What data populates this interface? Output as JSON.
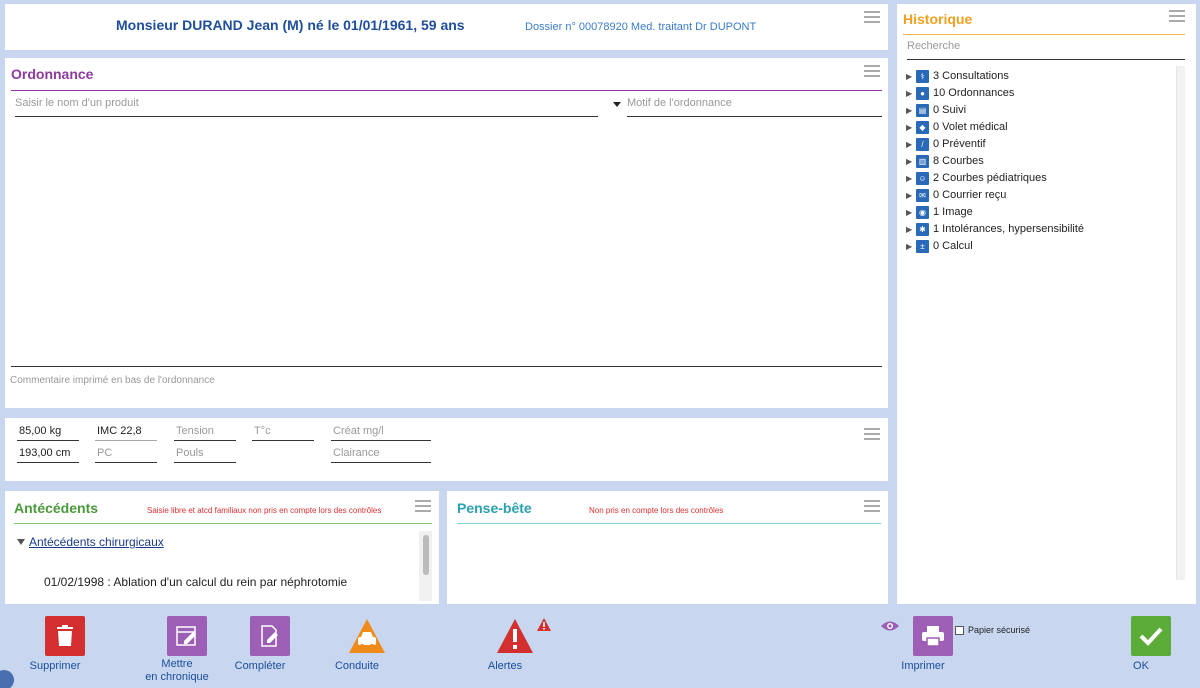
{
  "header": {
    "patient_name": "Monsieur DURAND Jean (M) né le 01/01/1961, 59 ans",
    "dossier": "Dossier n° 00078920 Med. traitant Dr DUPONT"
  },
  "ordonnance": {
    "title": "Ordonnance",
    "product_placeholder": "Saisir le nom d'un produit",
    "motif_placeholder": "Motif de l'ordonnance",
    "comment_placeholder": "Commentaire imprimé en bas de l'ordonnance"
  },
  "vitals": {
    "weight": "85,00 kg",
    "height": "193,00 cm",
    "imc": "IMC 22,8",
    "pc": "PC",
    "tension": "Tension",
    "pouls": "Pouls",
    "temp": "T°c",
    "creat": "Créat mg/l",
    "clairance": "Clairance"
  },
  "antecedents": {
    "title": "Antécédents",
    "note": "Saisie libre et atcd familiaux non pris en compte lors des contrôles",
    "group_label": "Antécédents chirurgicaux",
    "entry": "01/02/1998 : Ablation d'un calcul du rein par néphrotomie"
  },
  "pense_bete": {
    "title": "Pense-bête",
    "note": "Non pris en compte lors des contrôles"
  },
  "historique": {
    "title": "Historique",
    "search_placeholder": "Recherche",
    "items": [
      {
        "label": "3 Consultations",
        "icon": "stethoscope-icon"
      },
      {
        "label": "10 Ordonnances",
        "icon": "pill-icon"
      },
      {
        "label": "0 Suivi",
        "icon": "clipboard-icon"
      },
      {
        "label": "0 Volet médical",
        "icon": "group-icon"
      },
      {
        "label": "0 Préventif",
        "icon": "syringe-icon"
      },
      {
        "label": "8 Courbes",
        "icon": "chart-icon"
      },
      {
        "label": "2 Courbes pédiatriques",
        "icon": "baby-icon"
      },
      {
        "label": "0 Courrier reçu",
        "icon": "mail-icon"
      },
      {
        "label": "1 Image",
        "icon": "camera-icon"
      },
      {
        "label": "1 Intolérances, hypersensibilité",
        "icon": "bug-icon"
      },
      {
        "label": "0 Calcul",
        "icon": "calculator-icon"
      }
    ]
  },
  "toolbar": {
    "supprimer": "Supprimer",
    "chronique_line1": "Mettre",
    "chronique_line2": "en chronique",
    "completer": "Compléter",
    "conduite": "Conduite",
    "alertes": "Alertes",
    "imprimer": "Imprimer",
    "papier_securise": "Papier sécurisé",
    "ok": "OK"
  },
  "colors": {
    "accent_blue": "#1f4e9c",
    "ordonnance_purple": "#8e3a9e",
    "antecedents_green": "#4a9a3a",
    "pense_bete_teal": "#2aa0b0",
    "historique_orange": "#f0a020",
    "delete_red": "#d32f2f",
    "ok_green": "#5cac3a"
  }
}
